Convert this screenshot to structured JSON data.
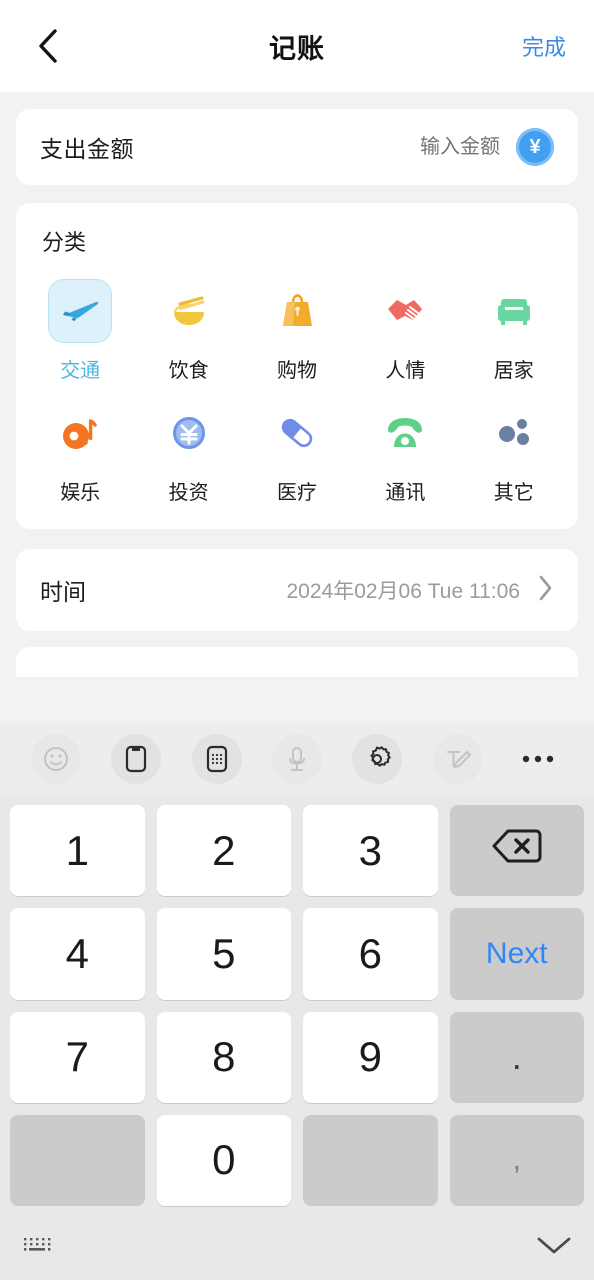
{
  "header": {
    "back_icon": "chevron-left-icon",
    "title": "记账",
    "done_label": "完成"
  },
  "amount": {
    "label": "支出金额",
    "value": "",
    "placeholder": "输入金额",
    "currency_icon": "yen-circle-icon",
    "currency_symbol": "¥",
    "accent_color": "#43a0f0"
  },
  "category": {
    "title": "分类",
    "selected_index": 0,
    "selected_color": "#4db5e8",
    "items": [
      {
        "label": "交通",
        "icon": "airplane-icon",
        "color": "#3aa6e0",
        "selected": true
      },
      {
        "label": "饮食",
        "icon": "noodle-bowl-icon",
        "color": "#f3c13a",
        "selected": false
      },
      {
        "label": "购物",
        "icon": "shopping-bag-icon",
        "color": "#f5a623",
        "selected": false
      },
      {
        "label": "人情",
        "icon": "handshake-icon",
        "color": "#ef6a63",
        "selected": false
      },
      {
        "label": "居家",
        "icon": "armchair-icon",
        "color": "#67d6a0",
        "selected": false
      },
      {
        "label": "娱乐",
        "icon": "music-record-icon",
        "color": "#f47521",
        "selected": false
      },
      {
        "label": "投资",
        "icon": "yen-coin-icon",
        "color": "#6f93e8",
        "selected": false
      },
      {
        "label": "医疗",
        "icon": "capsule-pill-icon",
        "color": "#6f8de8",
        "selected": false
      },
      {
        "label": "通讯",
        "icon": "telephone-icon",
        "color": "#5fd08a",
        "selected": false
      },
      {
        "label": "其它",
        "icon": "three-dots-icon",
        "color": "#6b7fa3",
        "selected": false
      }
    ]
  },
  "time": {
    "label": "时间",
    "value": "2024年02月06 Tue 11:06",
    "chevron_icon": "chevron-right-icon"
  },
  "keyboard": {
    "toolbar": [
      {
        "name": "emoji-icon",
        "faded": true
      },
      {
        "name": "clipboard-icon",
        "faded": false
      },
      {
        "name": "numpad-icon",
        "faded": false
      },
      {
        "name": "microphone-icon",
        "faded": true
      },
      {
        "name": "gear-icon",
        "faded": false
      },
      {
        "name": "handwriting-icon",
        "faded": true
      },
      {
        "name": "more-dots-icon",
        "faded": false
      }
    ],
    "keys": [
      {
        "label": "1",
        "type": "num"
      },
      {
        "label": "2",
        "type": "num"
      },
      {
        "label": "3",
        "type": "num"
      },
      {
        "label": "",
        "type": "backspace"
      },
      {
        "label": "4",
        "type": "num"
      },
      {
        "label": "5",
        "type": "num"
      },
      {
        "label": "6",
        "type": "num"
      },
      {
        "label": "Next",
        "type": "next"
      },
      {
        "label": "7",
        "type": "num"
      },
      {
        "label": "8",
        "type": "num"
      },
      {
        "label": "9",
        "type": "num"
      },
      {
        "label": ".",
        "type": "dot"
      },
      {
        "label": "",
        "type": "blank"
      },
      {
        "label": "0",
        "type": "num"
      },
      {
        "label": "",
        "type": "blank"
      },
      {
        "label": ",",
        "type": "comma"
      }
    ],
    "bottom": {
      "switch_icon": "keyboard-switch-icon",
      "hide_icon": "chevron-down-icon"
    }
  }
}
